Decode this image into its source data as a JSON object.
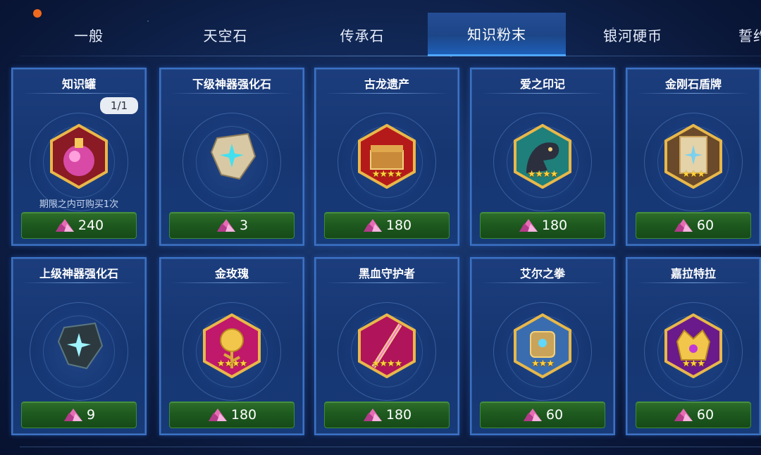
{
  "tabs": [
    {
      "label": "一般",
      "active": false
    },
    {
      "label": "天空石",
      "active": false
    },
    {
      "label": "传承石",
      "active": false
    },
    {
      "label": "知识粉末",
      "active": true
    },
    {
      "label": "银河硬币",
      "active": false
    },
    {
      "label": "誓约",
      "active": false
    }
  ],
  "colors": {
    "active_tab": "#1d4688",
    "price_button": "#1e5a1f",
    "card_border": "#3a72c6",
    "notification_dot": "#f06a1e"
  },
  "items": [
    {
      "name": "知识罐",
      "icon": "knowledge-jar-icon",
      "price": "240",
      "quantity": "1/1",
      "limit_text": "期限之内可购买1次",
      "stars": ""
    },
    {
      "name": "下级神器强化石",
      "icon": "lower-artifact-stone-icon",
      "price": "3",
      "stars": ""
    },
    {
      "name": "古龙遗产",
      "icon": "ancient-dragon-legacy-icon",
      "price": "180",
      "stars": "★★★★"
    },
    {
      "name": "爱之印记",
      "icon": "mark-of-love-icon",
      "price": "180",
      "stars": "★★★★"
    },
    {
      "name": "金刚石盾牌",
      "icon": "diamond-shield-icon",
      "price": "60",
      "stars": "★★★"
    },
    {
      "name": "上级神器强化石",
      "icon": "upper-artifact-stone-icon",
      "price": "9",
      "stars": ""
    },
    {
      "name": "金玫瑰",
      "icon": "golden-rose-icon",
      "price": "180",
      "stars": "★★★★"
    },
    {
      "name": "黑血守护者",
      "icon": "black-blood-guardian-icon",
      "price": "180",
      "stars": "★★★★"
    },
    {
      "name": "艾尔之拳",
      "icon": "fist-of-el-icon",
      "price": "60",
      "stars": "★★★"
    },
    {
      "name": "嘉拉特拉",
      "icon": "galatra-icon",
      "price": "60",
      "stars": "★★★"
    }
  ]
}
